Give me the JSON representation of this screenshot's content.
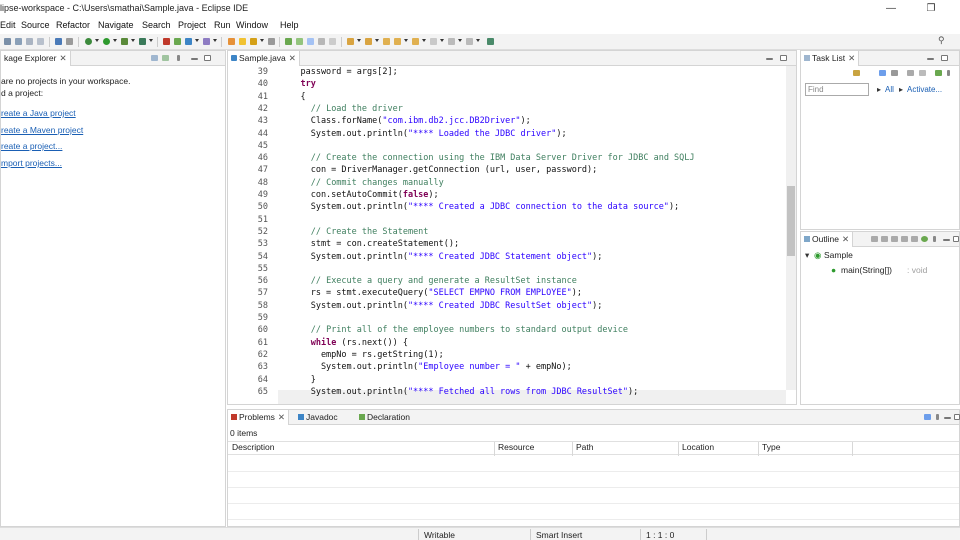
{
  "window": {
    "title": "lipse-workspace - C:\\Users\\smathai\\Sample.java - Eclipse IDE",
    "minimize": "—",
    "restore": "❐",
    "close": "✕"
  },
  "menu": [
    "Edit",
    "Source",
    "Refactor",
    "Navigate",
    "Search",
    "Project",
    "Run",
    "Window",
    "Help"
  ],
  "package_explorer": {
    "tab_label": "kage Explorer",
    "message_line1": "are no projects in your workspace.",
    "message_line2": "d a project:",
    "links": [
      "reate a Java project",
      "reate a Maven project",
      "reate a project...",
      "mport projects..."
    ]
  },
  "editor": {
    "tab_label": "Sample.java",
    "lines": [
      {
        "num": "39",
        "text": "    password = args[2];"
      },
      {
        "num": "40",
        "text": "    try"
      },
      {
        "num": "41",
        "text": "    {"
      },
      {
        "num": "42",
        "text": "      // Load the driver"
      },
      {
        "num": "43",
        "text": "      Class.forName(\"com.ibm.db2.jcc.DB2Driver\");"
      },
      {
        "num": "44",
        "text": "      System.out.println(\"**** Loaded the JDBC driver\");"
      },
      {
        "num": "45",
        "text": ""
      },
      {
        "num": "46",
        "text": "      // Create the connection using the IBM Data Server Driver for JDBC and SQLJ"
      },
      {
        "num": "47",
        "text": "      con = DriverManager.getConnection (url, user, password);"
      },
      {
        "num": "48",
        "text": "      // Commit changes manually"
      },
      {
        "num": "49",
        "text": "      con.setAutoCommit(false);"
      },
      {
        "num": "50",
        "text": "      System.out.println(\"**** Created a JDBC connection to the data source\");"
      },
      {
        "num": "51",
        "text": ""
      },
      {
        "num": "52",
        "text": "      // Create the Statement"
      },
      {
        "num": "53",
        "text": "      stmt = con.createStatement();"
      },
      {
        "num": "54",
        "text": "      System.out.println(\"**** Created JDBC Statement object\");"
      },
      {
        "num": "55",
        "text": ""
      },
      {
        "num": "56",
        "text": "      // Execute a query and generate a ResultSet instance"
      },
      {
        "num": "57",
        "text": "      rs = stmt.executeQuery(\"SELECT EMPNO FROM EMPLOYEE\");"
      },
      {
        "num": "58",
        "text": "      System.out.println(\"**** Created JDBC ResultSet object\");"
      },
      {
        "num": "59",
        "text": ""
      },
      {
        "num": "60",
        "text": "      // Print all of the employee numbers to standard output device"
      },
      {
        "num": "61",
        "text": "      while (rs.next()) {"
      },
      {
        "num": "62",
        "text": "        empNo = rs.getString(1);"
      },
      {
        "num": "63",
        "text": "        System.out.println(\"Employee number = \" + empNo);"
      },
      {
        "num": "64",
        "text": "      }"
      },
      {
        "num": "65",
        "text": "      System.out.println(\"**** Fetched all rows from JDBC ResultSet\");"
      }
    ]
  },
  "task_list": {
    "tab_label": "Task List",
    "find_placeholder": "Find",
    "all_label": "All",
    "activate_label": "Activate..."
  },
  "outline": {
    "tab_label": "Outline",
    "class_name": "Sample",
    "method_name": "main(String[])",
    "method_return": ": void"
  },
  "bottom": {
    "tabs": [
      "Problems",
      "Javadoc",
      "Declaration"
    ],
    "items_count": "0 items",
    "columns": [
      "Description",
      "Resource",
      "Path",
      "Location",
      "Type"
    ]
  },
  "status": {
    "writable": "Writable",
    "insert_mode": "Smart Insert",
    "position": "1 : 1 : 0"
  },
  "colors": {
    "comment": "#3f7f5f",
    "keyword": "#7f0055",
    "string": "#2a00ff",
    "link": "#1a5fb4"
  }
}
